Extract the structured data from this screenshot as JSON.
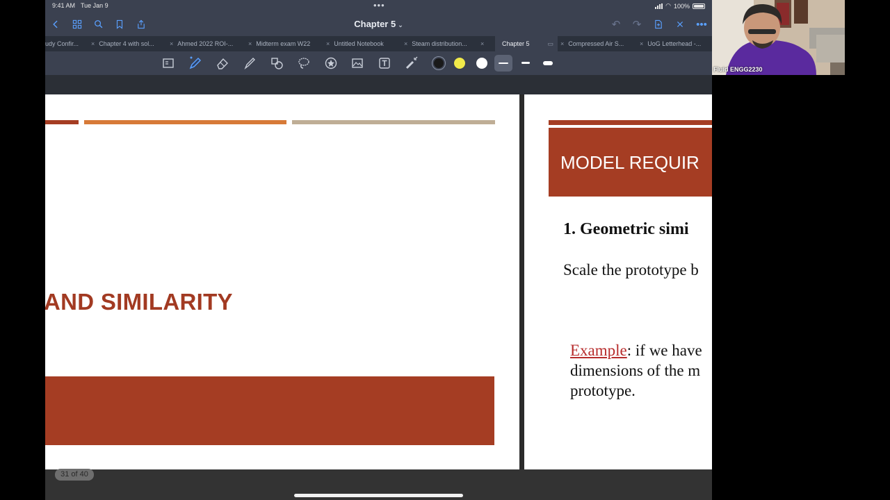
{
  "status": {
    "time": "9:41 AM",
    "date": "Tue Jan 9",
    "battery": "100%"
  },
  "nav": {
    "title": "Chapter 5"
  },
  "tabs": [
    {
      "label": "udy Confir..."
    },
    {
      "label": "Chapter 4 with sol..."
    },
    {
      "label": "Ahmed 2022 ROI-..."
    },
    {
      "label": "Midterm exam W22"
    },
    {
      "label": "Untitled Notebook"
    },
    {
      "label": "Steam distribution..."
    },
    {
      "label": "Chapter 5"
    },
    {
      "label": "Compressed Air S..."
    },
    {
      "label": "UoG Letterhead -..."
    }
  ],
  "toolbar": {
    "colors": [
      "#1a1a1a",
      "#f1ea4a",
      "#ffffff"
    ]
  },
  "slide_left": {
    "title": "AND SIMILARITY"
  },
  "slide_right": {
    "header": "MODEL REQUIR",
    "heading": "1. Geometric simi",
    "line1": "Scale the prototype b",
    "example_label": "Example",
    "example_rest": ": if we have",
    "example_line2": "dimensions of the m",
    "example_line3": "prototype."
  },
  "page_counter": "31 of 40",
  "video": {
    "participant": "Fluid ENGG2230"
  },
  "colors": {
    "accent_blue": "#5aa0ff",
    "slide_red": "#a53d23",
    "slide_orange": "#d77a38",
    "slide_tan": "#bfae96"
  }
}
